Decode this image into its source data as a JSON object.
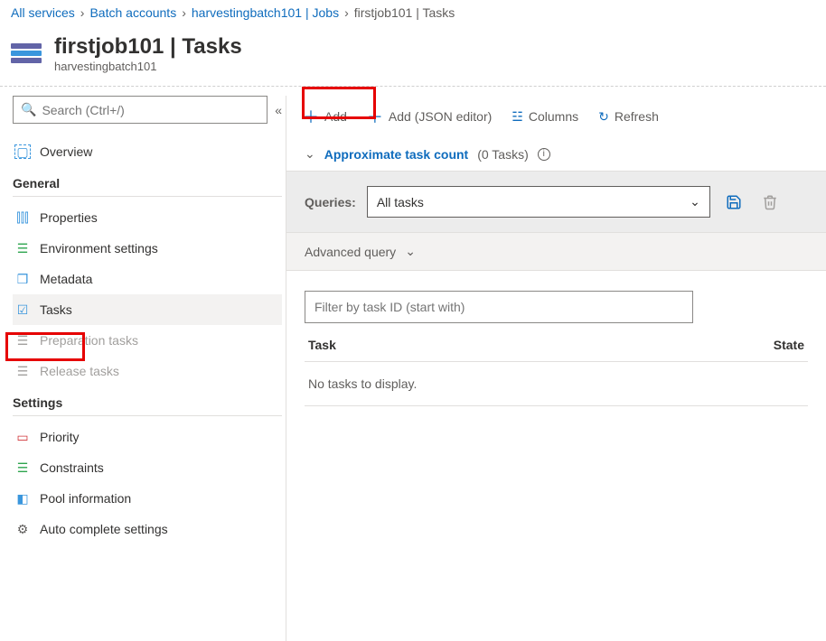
{
  "breadcrumb": {
    "items": [
      "All services",
      "Batch accounts",
      "harvestingbatch101 | Jobs"
    ],
    "current": "firstjob101 | Tasks"
  },
  "header": {
    "title": "firstjob101 | Tasks",
    "subtitle": "harvestingbatch101"
  },
  "sidebar": {
    "search_placeholder": "Search (Ctrl+/)",
    "overview": "Overview",
    "general_label": "General",
    "general": [
      {
        "label": "Properties"
      },
      {
        "label": "Environment settings"
      },
      {
        "label": "Metadata"
      },
      {
        "label": "Tasks"
      },
      {
        "label": "Preparation tasks"
      },
      {
        "label": "Release tasks"
      }
    ],
    "settings_label": "Settings",
    "settings": [
      {
        "label": "Priority"
      },
      {
        "label": "Constraints"
      },
      {
        "label": "Pool information"
      },
      {
        "label": "Auto complete settings"
      }
    ]
  },
  "toolbar": {
    "add": "Add",
    "add_json": "Add (JSON editor)",
    "columns": "Columns",
    "refresh": "Refresh"
  },
  "taskcount": {
    "label": "Approximate task count",
    "count_text": "(0 Tasks)"
  },
  "queries": {
    "label": "Queries:",
    "selected": "All tasks"
  },
  "advanced_query": "Advanced query",
  "filter_placeholder": "Filter by task ID (start with)",
  "table": {
    "col_task": "Task",
    "col_state": "State",
    "empty": "No tasks to display."
  }
}
